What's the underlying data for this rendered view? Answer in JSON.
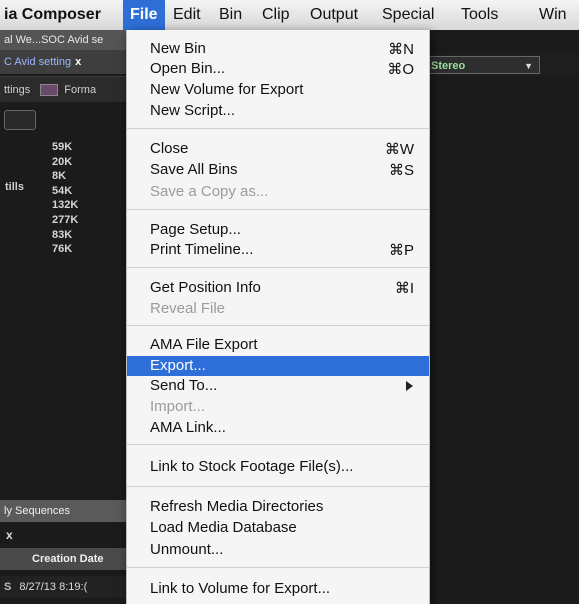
{
  "menubar": {
    "app_title": "ia Composer",
    "items": [
      "File",
      "Edit",
      "Bin",
      "Clip",
      "Output",
      "Special",
      "Tools",
      "Win"
    ]
  },
  "background": {
    "tab1": "al We...SOC Avid se",
    "tab2": "C Avid setting",
    "tab2_close": "x",
    "tab3_left": "ttings",
    "tab3_right": "Forma",
    "stills_label": "tills",
    "sizes": [
      "59K",
      "20K",
      "8K",
      "54K",
      "132K",
      "277K",
      "83K",
      "76K"
    ],
    "stereo_label": "Stereo",
    "sequences_tab": "ly Sequences",
    "close_mark": "x",
    "column_header": "Creation Date",
    "row_prefix": "S",
    "row_date": "8/27/13 8:19:("
  },
  "file_menu": {
    "new_bin": "New Bin",
    "new_bin_sc": "⌘N",
    "open_bin": "Open Bin...",
    "open_bin_sc": "⌘O",
    "new_volume": "New Volume for Export",
    "new_script": "New Script...",
    "close": "Close",
    "close_sc": "⌘W",
    "save_all": "Save All Bins",
    "save_all_sc": "⌘S",
    "save_copy": "Save a Copy as...",
    "page_setup": "Page Setup...",
    "print_timeline": "Print Timeline...",
    "print_timeline_sc": "⌘P",
    "get_position": "Get Position Info",
    "get_position_sc": "⌘I",
    "reveal_file": "Reveal File",
    "ama_export": "AMA File Export",
    "export": "Export...",
    "send_to": "Send To...",
    "import": "Import...",
    "ama_link": "AMA Link...",
    "link_stock": "Link to Stock Footage File(s)...",
    "refresh_media": "Refresh Media Directories",
    "load_media_db": "Load Media Database",
    "unmount": "Unmount...",
    "link_volume": "Link to Volume for Export..."
  }
}
